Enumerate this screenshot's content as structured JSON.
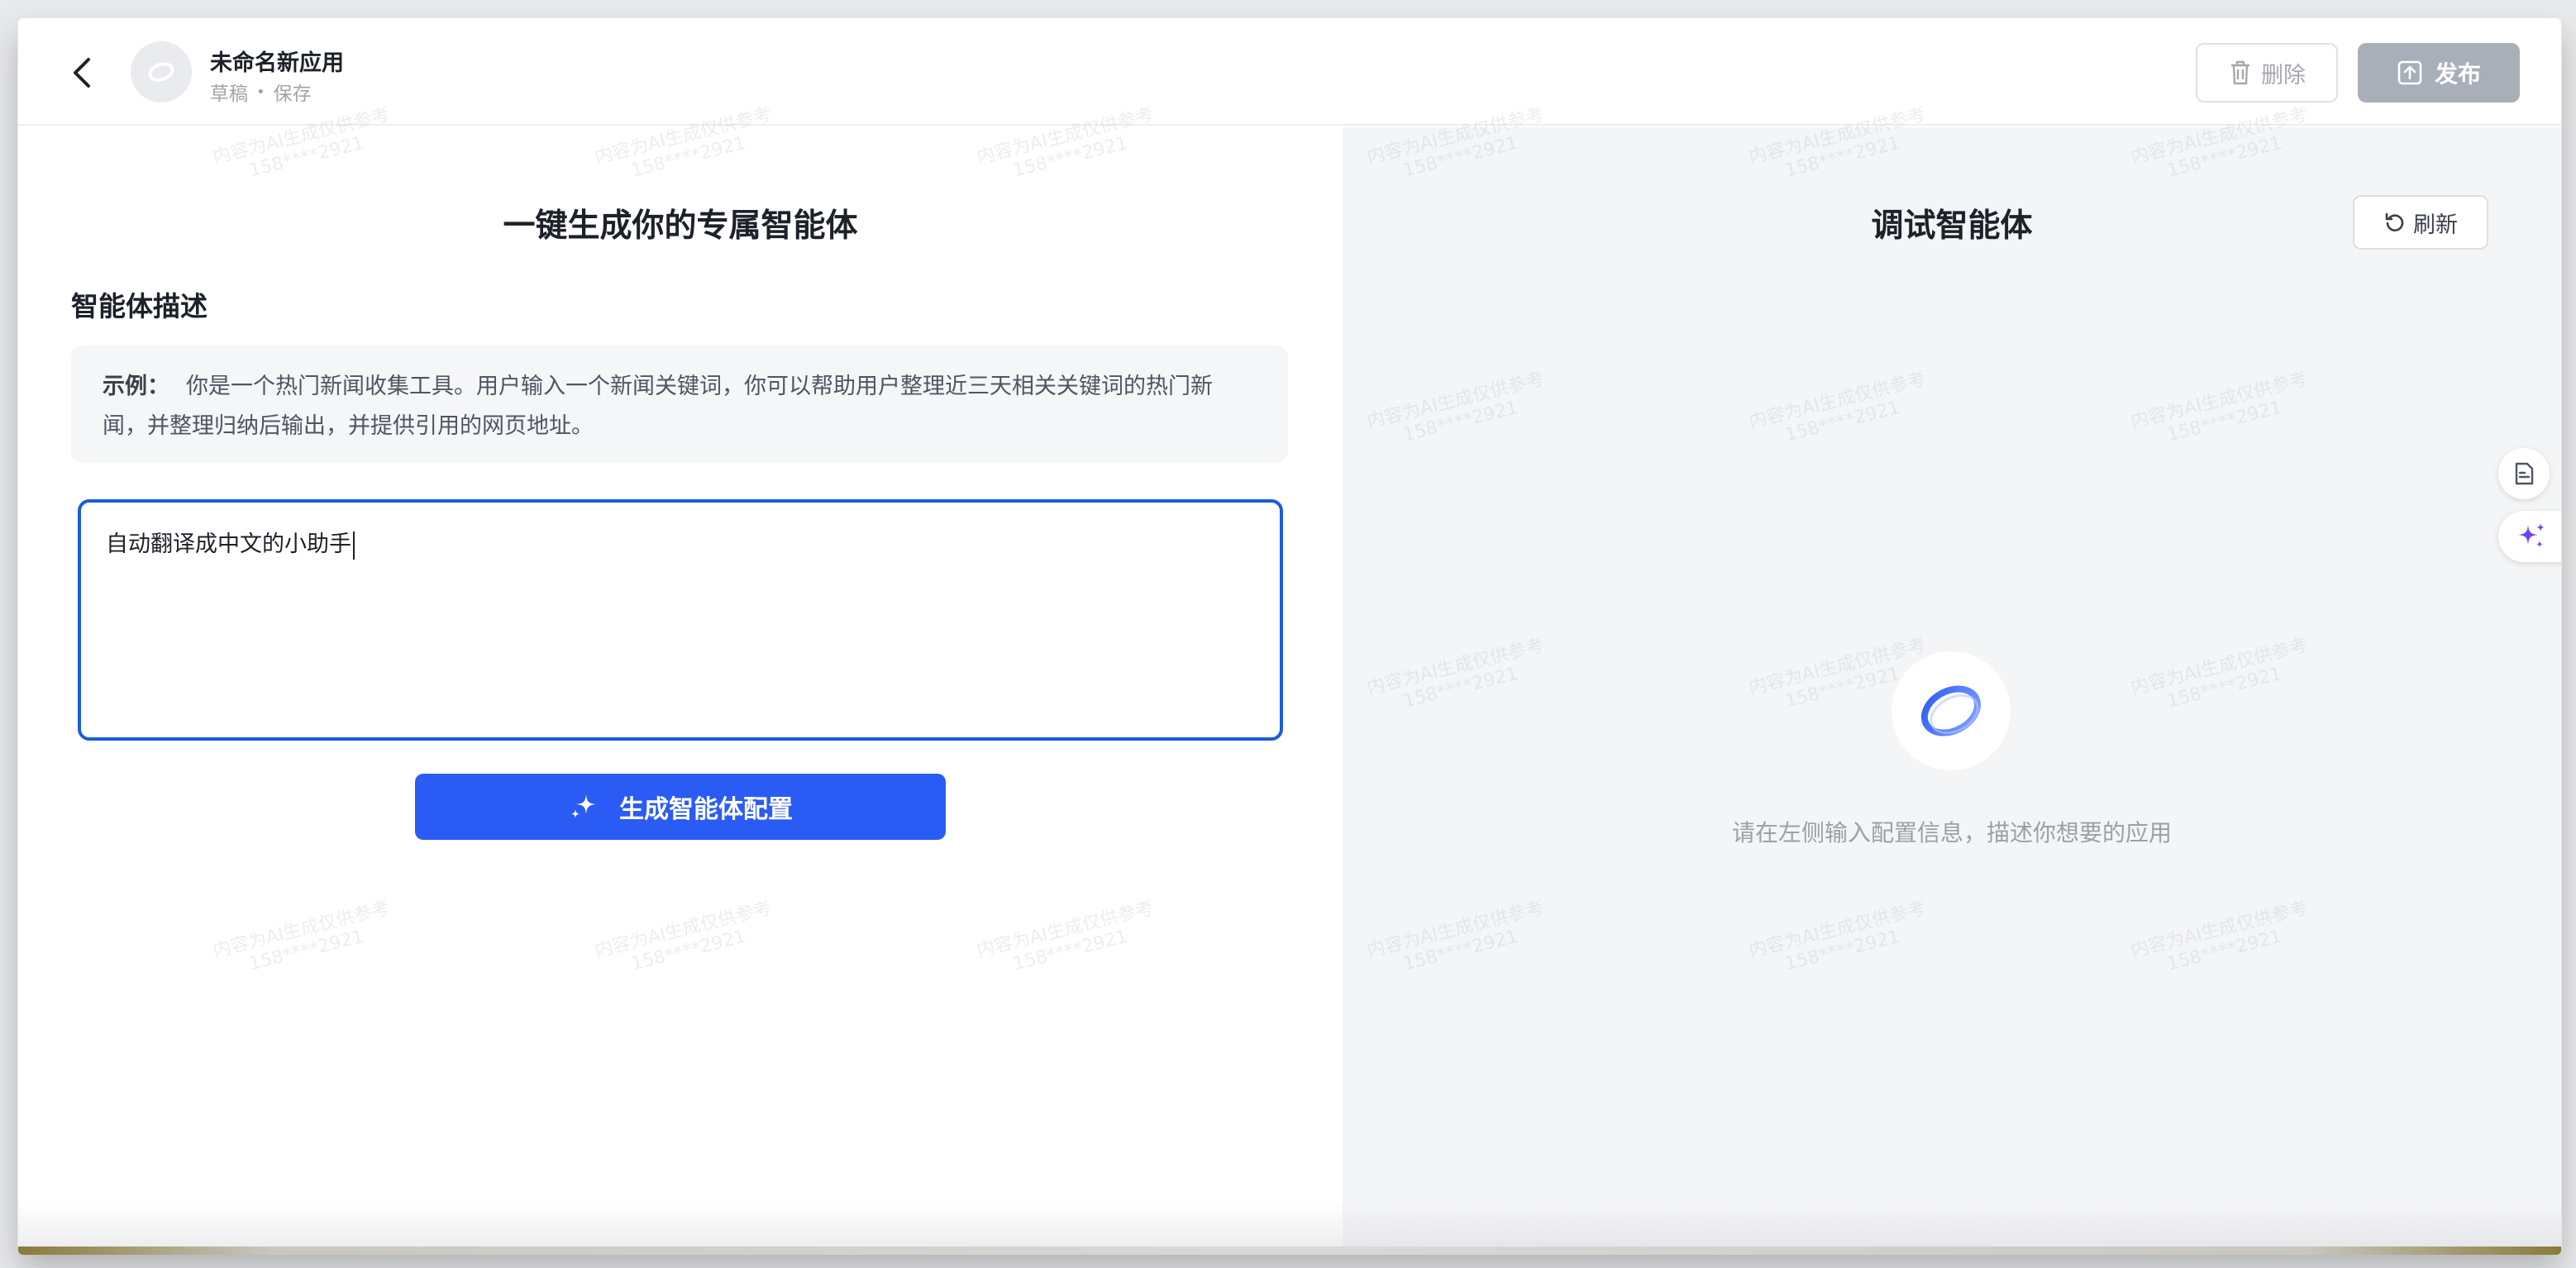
{
  "header": {
    "app_title": "未命名新应用",
    "status_draft": "草稿",
    "status_dot": "•",
    "status_save": "保存",
    "delete_label": "删除",
    "publish_label": "发布"
  },
  "left_panel": {
    "title": "一键生成你的专属智能体",
    "section_label": "智能体描述",
    "example_label": "示例：",
    "example_text": "你是一个热门新闻收集工具。用户输入一个新闻关键词，你可以帮助用户整理近三天相关关键词的热门新闻，并整理归纳后输出，并提供引用的网页地址。",
    "description_value": "自动翻译成中文的小助手",
    "generate_button": "生成智能体配置"
  },
  "right_panel": {
    "title": "调试智能体",
    "refresh_label": "刷新",
    "empty_hint": "请在左侧输入配置信息，描述你想要的应用"
  },
  "watermark": {
    "line1": "内容为AI生成仅供参考",
    "line2": "158****2921"
  },
  "icons": {
    "back": "chevron-left-icon",
    "avatar": "app-logo-icon",
    "delete": "trash-icon",
    "publish": "upload-icon",
    "generate": "sparkle-icon",
    "refresh": "refresh-icon",
    "side_tool_1": "document-icon",
    "side_tool_2": "ai-sparkle-icon"
  },
  "colors": {
    "accent": "#2b5bf5",
    "input_focus": "#1a5ddc",
    "publish_disabled": "#a9afb9",
    "right_panel_bg": "#f4f5f7"
  }
}
